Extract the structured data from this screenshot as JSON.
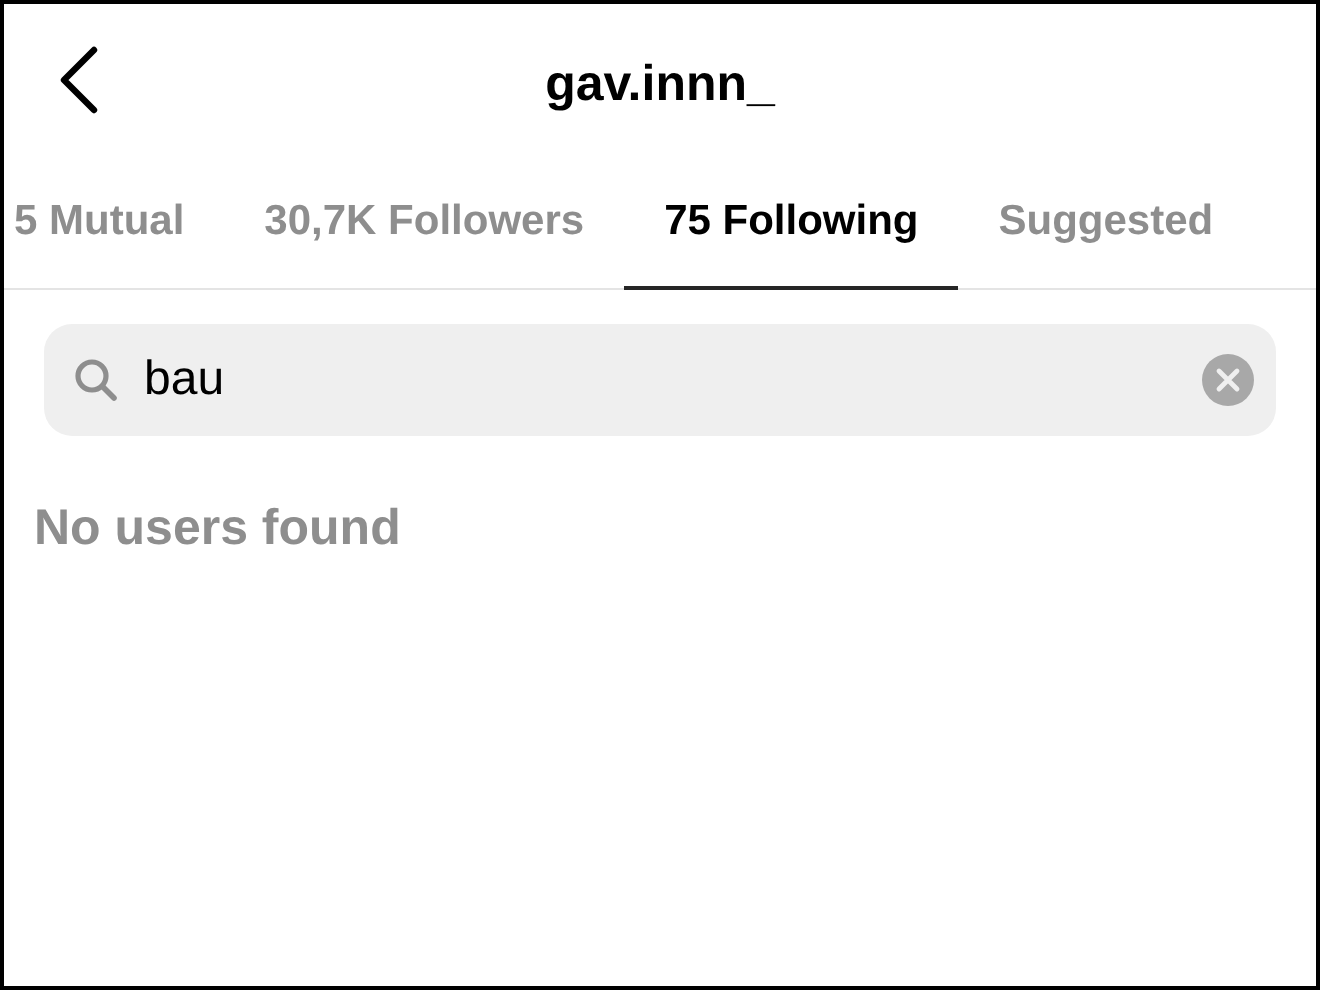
{
  "header": {
    "title": "gav.innn_"
  },
  "tabs": [
    {
      "label": "5 Mutual",
      "selected": false
    },
    {
      "label": "30,7K Followers",
      "selected": false
    },
    {
      "label": "75 Following",
      "selected": true
    },
    {
      "label": "Suggested",
      "selected": false
    }
  ],
  "search": {
    "value": "bau"
  },
  "empty_message": "No users found"
}
